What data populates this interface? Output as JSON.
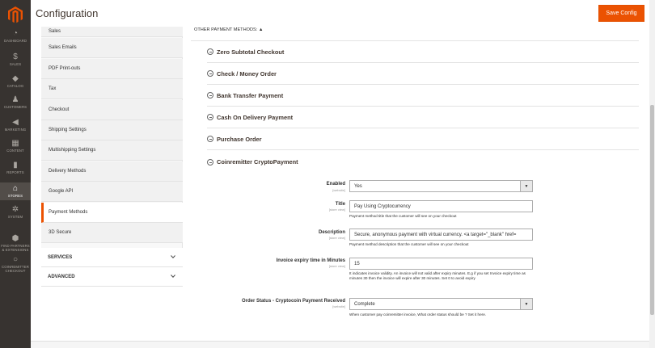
{
  "nav": {
    "items": [
      {
        "label": "DASHBOARD",
        "icon": "speedometer-icon",
        "glyph": "◔"
      },
      {
        "label": "SALES",
        "icon": "dollar-icon",
        "glyph": "$"
      },
      {
        "label": "CATALOG",
        "icon": "cube-icon",
        "glyph": "◆"
      },
      {
        "label": "CUSTOMERS",
        "icon": "person-icon",
        "glyph": "♟"
      },
      {
        "label": "MARKETING",
        "icon": "megaphone-icon",
        "glyph": "◀"
      },
      {
        "label": "CONTENT",
        "icon": "layout-icon",
        "glyph": "▦"
      },
      {
        "label": "REPORTS",
        "icon": "bar-chart-icon",
        "glyph": "▮"
      },
      {
        "label": "STORES",
        "icon": "store-icon",
        "glyph": "⌂"
      },
      {
        "label": "SYSTEM",
        "icon": "gear-icon",
        "glyph": "✲"
      },
      {
        "label": "FIND PARTNERS & EXTENSIONS",
        "icon": "blocks-icon",
        "glyph": "⬢"
      },
      {
        "label": "COINREMITTER CHECKOUT",
        "icon": "circle-icon",
        "glyph": "○"
      }
    ]
  },
  "header": {
    "title": "Configuration",
    "save_label": "Save Config"
  },
  "sidebar": {
    "items": [
      {
        "label": "Sales"
      },
      {
        "label": "Sales Emails"
      },
      {
        "label": "PDF Print-outs"
      },
      {
        "label": "Tax"
      },
      {
        "label": "Checkout"
      },
      {
        "label": "Shipping Settings"
      },
      {
        "label": "Multishipping Settings"
      },
      {
        "label": "Delivery Methods"
      },
      {
        "label": "Google API"
      },
      {
        "label": "Payment Methods"
      },
      {
        "label": "3D Secure"
      }
    ],
    "groups": [
      {
        "label": "SERVICES"
      },
      {
        "label": "ADVANCED"
      }
    ]
  },
  "main": {
    "other_title": "OTHER PAYMENT METHODS: ▲",
    "sections": [
      {
        "name": "Zero Subtotal Checkout"
      },
      {
        "name": "Check / Money Order"
      },
      {
        "name": "Bank Transfer Payment"
      },
      {
        "name": "Cash On Delivery Payment"
      },
      {
        "name": "Purchase Order"
      },
      {
        "name": "Coinremitter CryptoPayment"
      }
    ],
    "fields": {
      "enabled": {
        "label": "Enabled",
        "scope": "[website]",
        "value": "Yes"
      },
      "title": {
        "label": "Title",
        "scope": "[store view]",
        "value": "Pay Using Cryptocurrency",
        "note": "Payment method title that the customer will see on your checkout"
      },
      "description": {
        "label": "Description",
        "scope": "[store view]",
        "value": "Secure, anonymous payment with virtual currency. <a target=\"_blank\" href=",
        "note": "Payment method description that the customer will see on your checkout"
      },
      "expiry": {
        "label": "Invoice expiry time in Minutes",
        "scope": "[store view]",
        "value": "15",
        "note": "It indicates invoice validity. An invoice will not valid after expiry minutes. E.g if you set Invoice expiry time as minutes 30 then the invoice will expire after 30 minutes. Set 0 to avoid expiry"
      },
      "order_status": {
        "label": "Order Status - Cryptocoin Payment Received",
        "scope": "[website]",
        "value": "Complete",
        "note": "When customer pay coinremitter invoice, What order status should be ? Set it here."
      }
    }
  },
  "colors": {
    "accent": "#eb5202",
    "nav_bg": "#373330"
  }
}
